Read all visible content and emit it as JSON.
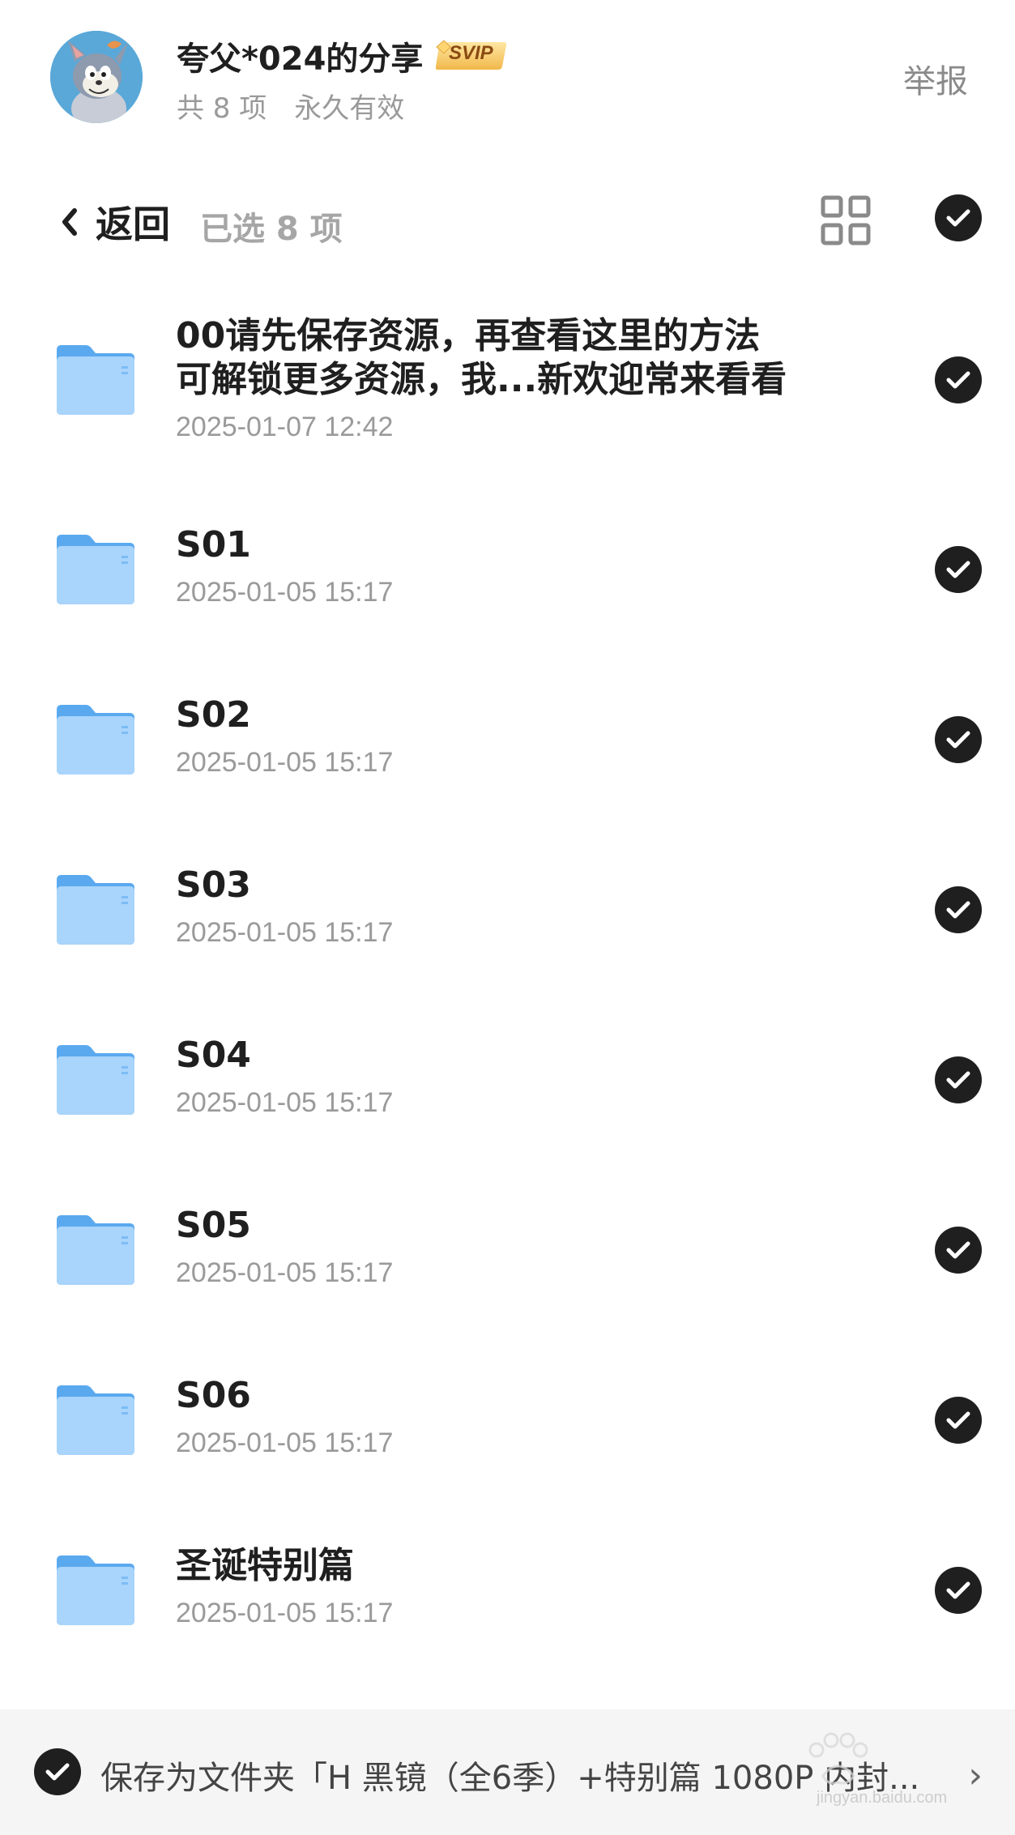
{
  "header": {
    "share_title": "夸父*024的分享",
    "badge": "SVIP",
    "item_count": "共 8 项",
    "validity": "永久有效",
    "report_label": "举报"
  },
  "toolbar": {
    "back_label": "返回",
    "selected_label": "已选 8 项"
  },
  "files": [
    {
      "name_line1": "00请先保存资源，再查看这里的方法",
      "name_line2": "可解锁更多资源，我...新欢迎常来看看",
      "date": "2025-01-07 12:42",
      "selected": true
    },
    {
      "name": "S01",
      "date": "2025-01-05 15:17",
      "selected": true
    },
    {
      "name": "S02",
      "date": "2025-01-05 15:17",
      "selected": true
    },
    {
      "name": "S03",
      "date": "2025-01-05 15:17",
      "selected": true
    },
    {
      "name": "S04",
      "date": "2025-01-05 15:17",
      "selected": true
    },
    {
      "name": "S05",
      "date": "2025-01-05 15:17",
      "selected": true
    },
    {
      "name": "S06",
      "date": "2025-01-05 15:17",
      "selected": true
    },
    {
      "name": "圣诞特别篇",
      "date": "2025-01-05 15:17",
      "selected": true
    }
  ],
  "save_bar": {
    "text": "保存为文件夹「H 黑镜（全6季）+特别篇 1080P 内封...",
    "watermark_text": "jingyan.baidu.com"
  },
  "colors": {
    "folder_light": "#a9d4fb",
    "folder_dark": "#5aa9ef",
    "check_bg": "#1f1f1f",
    "badge_gold": "#f5c451"
  },
  "icons": {
    "grid_view": "grid-view-icon",
    "check": "checkmark-icon",
    "folder": "folder-icon",
    "back": "chevron-left-icon"
  }
}
